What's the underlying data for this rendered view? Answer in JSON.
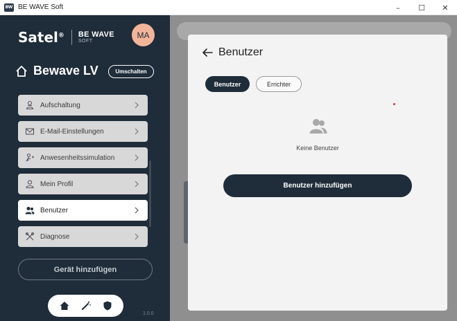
{
  "window": {
    "title": "BE WAVE Soft",
    "app_icon_text": "BW",
    "minimize_glyph": "–",
    "maximize_glyph": "☐",
    "close_glyph": "✕"
  },
  "sidebar": {
    "brand": "Satel",
    "brand_mark": "®",
    "product_line1": "BE WAVE",
    "product_line2": "SOFT",
    "avatar_initials": "MA",
    "house_name": "Bewave LV",
    "switch_label": "Umschalten",
    "menu": [
      {
        "label": "Aufschaltung",
        "icon": "guard-person-icon",
        "active": false
      },
      {
        "label": "E-Mail-Einstellungen",
        "icon": "mail-icon",
        "active": false
      },
      {
        "label": "Anwesenheitssimulation",
        "icon": "presence-simulation-icon",
        "active": false
      },
      {
        "label": "Mein Profil",
        "icon": "user-icon",
        "active": false
      },
      {
        "label": "Benutzer",
        "icon": "users-icon",
        "active": true
      },
      {
        "label": "Diagnose",
        "icon": "tools-icon",
        "active": false
      }
    ],
    "add_device_label": "Gerät hinzufügen",
    "bottom_nav": [
      {
        "icon": "home-icon"
      },
      {
        "icon": "magic-wand-icon"
      },
      {
        "icon": "shield-icon"
      }
    ],
    "version": "1.0.0"
  },
  "panel": {
    "title": "Benutzer",
    "tabs": [
      {
        "label": "Benutzer",
        "active": true
      },
      {
        "label": "Errichter",
        "active": false
      }
    ],
    "empty_text": "Keine Benutzer",
    "add_user_label": "Benutzer hinzufügen"
  },
  "colors": {
    "sidebar_bg": "#1f2c39",
    "accent_dark": "#1f2c39",
    "avatar_bg": "#f3b59a",
    "panel_bg": "#f3f3f3"
  }
}
